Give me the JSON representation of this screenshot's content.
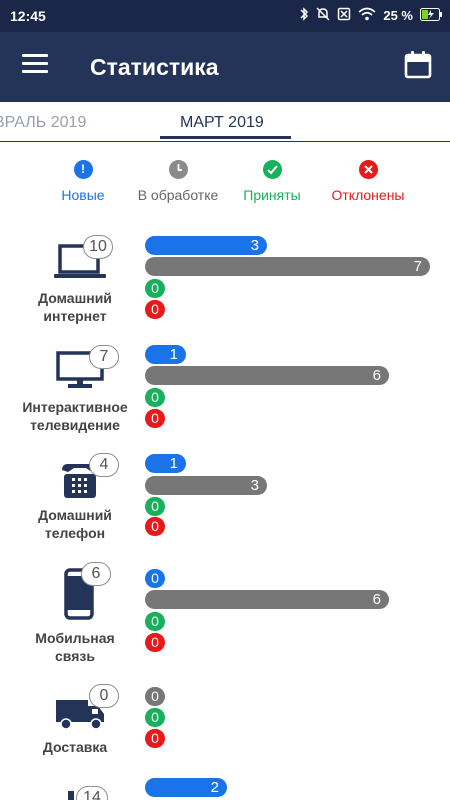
{
  "status_bar": {
    "time": "12:45",
    "battery": "25 %"
  },
  "app_bar": {
    "title": "Статистика"
  },
  "tabs": {
    "previous": "ВРАЛЬ 2019",
    "current": "МАРТ 2019"
  },
  "legend": [
    {
      "label": "Новые",
      "color": "#1a73e8",
      "icon": "exclamation-icon"
    },
    {
      "label": "В обработке",
      "color": "#666666",
      "icon": "clock-icon"
    },
    {
      "label": "Приняты",
      "color": "#17b15c",
      "icon": "check-icon"
    },
    {
      "label": "Отклонены",
      "color": "#e61a1a",
      "icon": "cross-icon"
    }
  ],
  "categories": [
    {
      "label_line1": "Домашний",
      "label_line2": "интернет",
      "total": "10",
      "new": "3",
      "processing": "7",
      "accepted": "0",
      "rejected": "0",
      "icon": "laptop-icon"
    },
    {
      "label_line1": "Интерактивное",
      "label_line2": "телевидение",
      "total": "7",
      "new": "1",
      "processing": "6",
      "accepted": "0",
      "rejected": "0",
      "icon": "tv-icon"
    },
    {
      "label_line1": "Домашний",
      "label_line2": "телефон",
      "total": "4",
      "new": "1",
      "processing": "3",
      "accepted": "0",
      "rejected": "0",
      "icon": "phone-icon"
    },
    {
      "label_line1": "Мобильная",
      "label_line2": "связь",
      "total": "6",
      "new": "0",
      "processing": "6",
      "accepted": "0",
      "rejected": "0",
      "icon": "smartphone-icon"
    },
    {
      "label_line1": "Доставка",
      "label_line2": "",
      "total": "0",
      "new": "",
      "processing": "0",
      "accepted": "0",
      "rejected": "0",
      "icon": "truck-icon"
    },
    {
      "label_line1": "",
      "label_line2": "",
      "total": "14",
      "new": "2",
      "processing": "",
      "accepted": "",
      "rejected": "",
      "icon": "device-icon"
    }
  ]
}
